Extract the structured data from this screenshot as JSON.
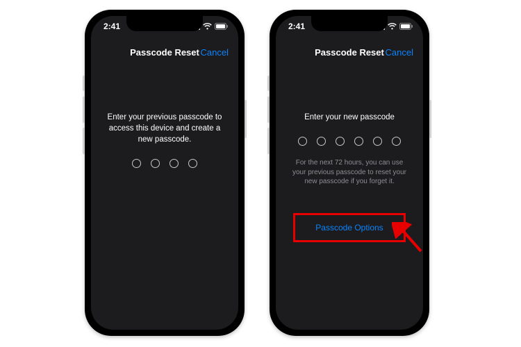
{
  "status": {
    "time": "2:41"
  },
  "screens": {
    "left": {
      "title": "Passcode Reset",
      "cancel": "Cancel",
      "prompt": "Enter your previous passcode to access this device and create a new passcode.",
      "dot_count": 4
    },
    "right": {
      "title": "Passcode Reset",
      "cancel": "Cancel",
      "prompt": "Enter your new passcode",
      "dot_count": 6,
      "hint": "For the next 72 hours, you can use your previous passcode to reset your new passcode if you forget it.",
      "options_label": "Passcode Options"
    }
  },
  "colors": {
    "accent": "#0a84ff",
    "highlight": "#e80000",
    "bg": "#1c1c1e"
  }
}
